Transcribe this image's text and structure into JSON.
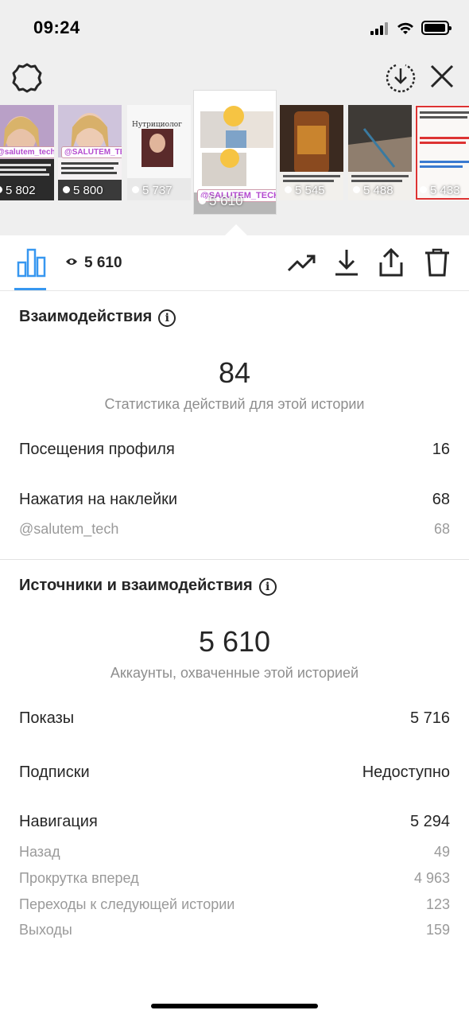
{
  "status_bar": {
    "time": "09:24"
  },
  "thumbnails": [
    {
      "views": "5 802",
      "tag": "@salutem_tech"
    },
    {
      "views": "5 800",
      "tag": "@SALUTEM_TECH"
    },
    {
      "views": "5 737",
      "label": "Нутрициолог"
    },
    {
      "views": "5 610",
      "tag": "@SALUTEM_TECH"
    },
    {
      "views": "5 545"
    },
    {
      "views": "5 488"
    },
    {
      "views": "5 433"
    }
  ],
  "toolbar": {
    "views_count": "5 610"
  },
  "interactions": {
    "title": "Взаимодействия",
    "total": "84",
    "caption": "Статистика действий для этой истории",
    "profile_visits_label": "Посещения профиля",
    "profile_visits_value": "16",
    "sticker_taps_label": "Нажатия на наклейки",
    "sticker_taps_value": "68",
    "sticker_account_label": "@salutem_tech",
    "sticker_account_value": "68"
  },
  "discovery": {
    "title": "Источники и взаимодействия",
    "total": "5 610",
    "caption": "Аккаунты, охваченные этой историей",
    "impressions_label": "Показы",
    "impressions_value": "5 716",
    "follows_label": "Подписки",
    "follows_value": "Недоступно",
    "navigation_label": "Навигация",
    "navigation_value": "5 294",
    "back_label": "Назад",
    "back_value": "49",
    "forward_label": "Прокрутка вперед",
    "forward_value": "4 963",
    "next_story_label": "Переходы к следующей истории",
    "next_story_value": "123",
    "exits_label": "Выходы",
    "exits_value": "159"
  },
  "colors": {
    "accent": "#3797f0",
    "text": "#262626",
    "muted": "#8e8e8e"
  }
}
